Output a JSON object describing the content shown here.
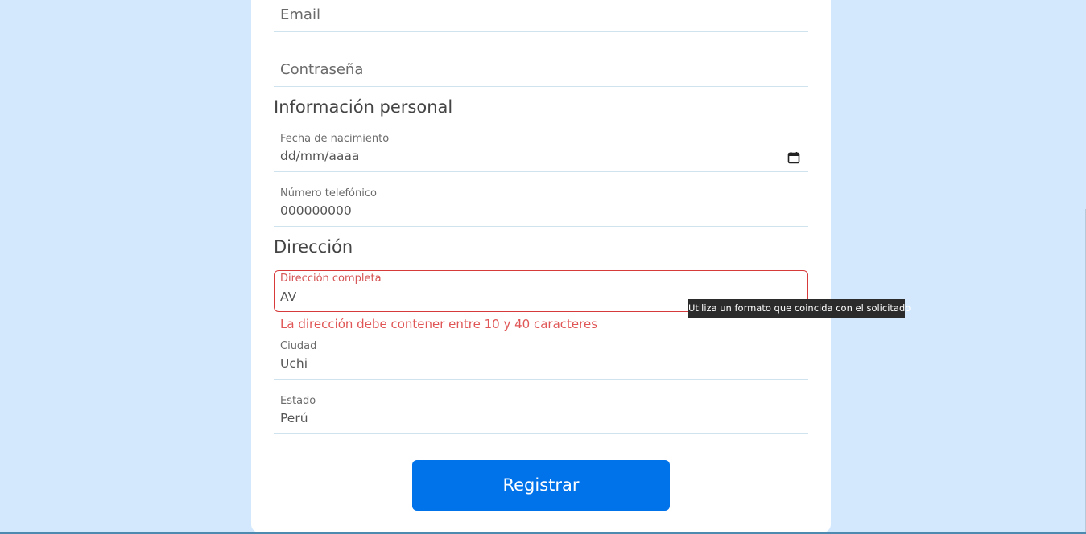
{
  "account": {
    "email_placeholder": "Email",
    "password_placeholder": "Contraseña"
  },
  "personal": {
    "title": "Información personal",
    "birthdate_label": "Fecha de nacimiento",
    "birthdate_value": "dd/mm/aaaa",
    "phone_label": "Número telefónico",
    "phone_value": "000000000"
  },
  "address": {
    "title": "Dirección",
    "full_label": "Dirección completa",
    "full_value": "AV",
    "error": "La dirección debe contener entre 10 y 40 caracteres",
    "tooltip": "Utiliza un formato que coincida con el solicitado",
    "city_label": "Ciudad",
    "city_value": "Uchi",
    "state_label": "Estado",
    "state_value": "Perú"
  },
  "submit_label": "Registrar",
  "colors": {
    "background": "#d3e8fd",
    "primary": "#0072ea",
    "error": "#d63a3a"
  }
}
